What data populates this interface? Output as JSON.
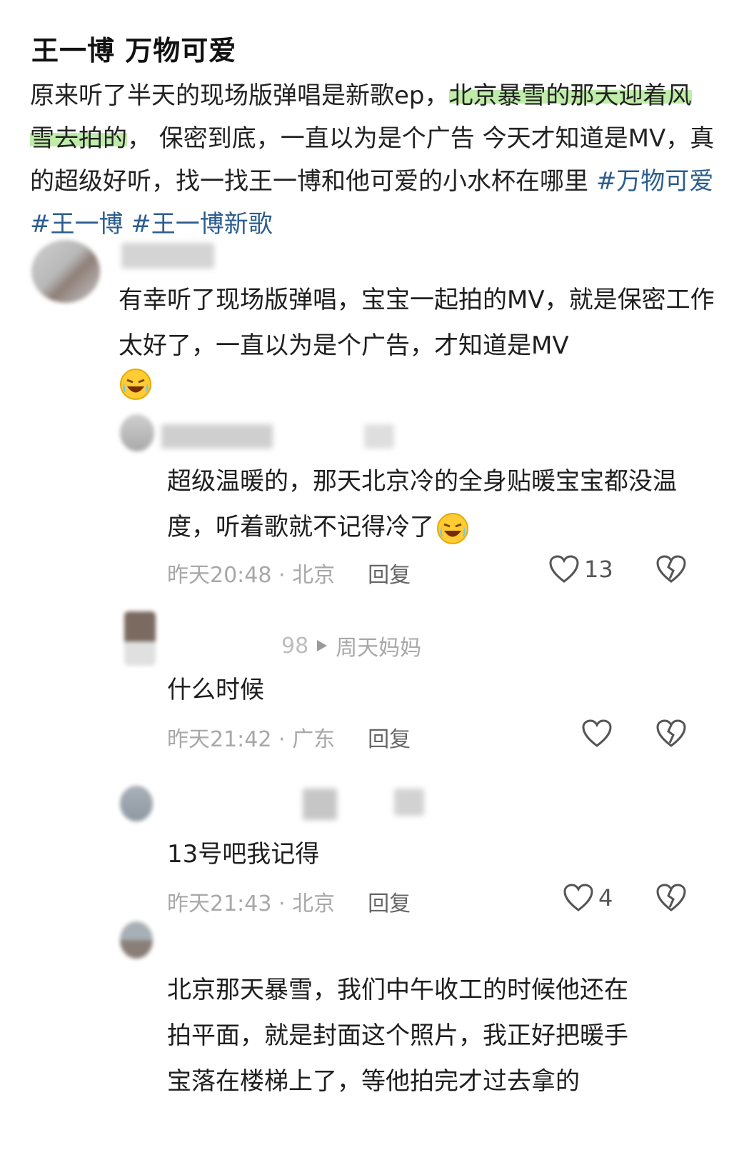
{
  "post": {
    "title": "王一博 万物可爱",
    "body_part1": "原来听了半天的现场版弹唱是新歌ep，",
    "body_highlight": "北京暴雪的那天迎着风雪去拍的",
    "body_part2": "， 保密到底，一直以为是个广告 今天才知道是MV，真的超级好听，找一找王一博和他可爱的小水杯在哪里 ",
    "tags": [
      "#万物可爱",
      "#王一博",
      " #王一博新歌"
    ]
  },
  "comments": [
    {
      "text": "有幸听了现场版弹唱，宝宝一起拍的MV，就是保密工作太好了，一直以为是个广告，才知道是MV",
      "emoji": "laughing-crying-emoji"
    },
    {
      "text": "超级温暖的，那天北京冷的全身贴暖宝宝都没温度，听着歌就不记得冷了",
      "emoji": "laughing-crying-emoji",
      "time": "昨天20:48 · 北京",
      "reply": "回复",
      "likes": "13"
    },
    {
      "name_suffix": "98",
      "reply_to": "周天妈妈",
      "text": "什么时候",
      "time": "昨天21:42 · 广东",
      "reply": "回复",
      "likes": ""
    },
    {
      "text": "13号吧我记得",
      "time": "昨天21:43 · 北京",
      "reply": "回复",
      "likes": "4"
    },
    {
      "text_line1": "北京那天暴雪，我们中午收工的时候他还在",
      "text_line2": "拍平面，就是封面这个照片，我正好把暖手",
      "text_line3": "宝落在楼梯上了，等他拍完才过去拿的"
    }
  ],
  "icons": {
    "like": "heart-outline-icon",
    "dislike": "broken-heart-icon",
    "play": "play-triangle-icon"
  },
  "colors": {
    "tag": "#2c5d8f",
    "highlight": "#8cdc64",
    "meta": "#a8a8a8"
  }
}
